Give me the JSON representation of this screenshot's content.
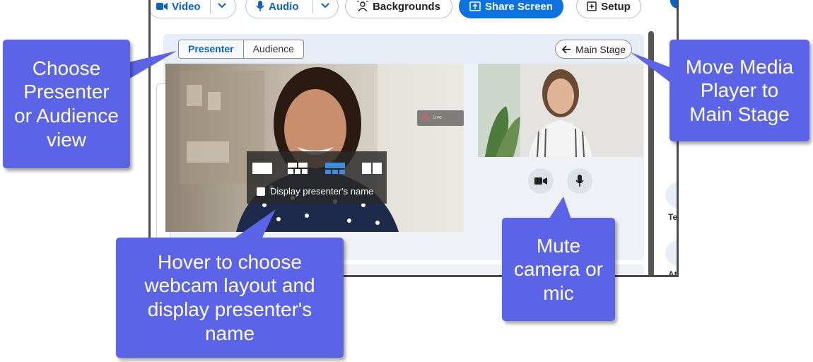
{
  "toolbar": {
    "video_label": "Video",
    "audio_label": "Audio",
    "backgrounds_label": "Backgrounds",
    "share_screen_label": "Share Screen",
    "setup_label": "Setup"
  },
  "view_toggle": {
    "options": [
      "Presenter",
      "Audience"
    ],
    "selected": "Presenter"
  },
  "main_stage_label": "Main Stage",
  "live_chip_label": "Live",
  "layout_popup": {
    "layouts": [
      "single",
      "grid-2x2",
      "grid-selected",
      "side-by-side"
    ],
    "selected_index": 2,
    "checkbox_label": "Display presenter's name",
    "checkbox_checked": false
  },
  "right_panel": {
    "stub_1_text": "Te",
    "stub_2_text": "At"
  },
  "callouts": {
    "view_toggle": "Choose\nPresenter\nor Audience\nview",
    "main_stage": "Move Media\nPlayer to\nMain Stage",
    "layout": "Hover to choose\nwebcam layout and\ndisplay presenter's\nname",
    "mute": "Mute\ncamera or\nmic"
  },
  "colors": {
    "callout": "#5b63e6",
    "accent": "#0b62c4",
    "primary_button": "#0b72e0"
  },
  "icons": [
    "video-camera-icon",
    "chevron-down-icon",
    "microphone-icon",
    "backgrounds-icon",
    "share-screen-icon",
    "setup-icon",
    "arrow-left-icon",
    "camera-icon",
    "mic-icon"
  ]
}
